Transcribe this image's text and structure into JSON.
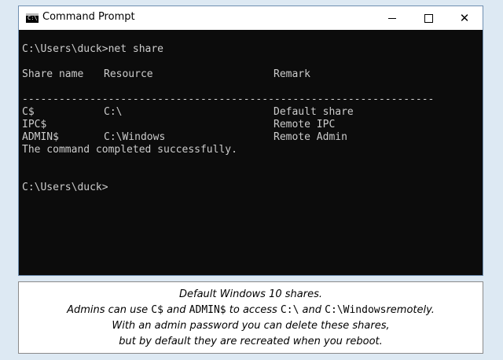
{
  "window": {
    "title": "Command Prompt",
    "icon": "cmd-icon",
    "icon_glyph": "C:\\",
    "controls": {
      "minimize": "minimize-icon",
      "maximize": "maximize-icon",
      "close": "close-icon",
      "close_glyph": "✕"
    }
  },
  "console": {
    "prompt1": "C:\\Users\\duck>net share",
    "header": {
      "share_name": "Share name",
      "resource": "Resource",
      "remark": "Remark"
    },
    "separator": "-------------------------------------------------------------------",
    "rows": [
      {
        "share": "C$",
        "resource": "C:\\",
        "remark": "Default share"
      },
      {
        "share": "IPC$",
        "resource": "",
        "remark": "Remote IPC"
      },
      {
        "share": "ADMIN$",
        "resource": "C:\\Windows",
        "remark": "Remote Admin"
      }
    ],
    "status": "The command completed successfully.",
    "prompt2": "C:\\Users\\duck>"
  },
  "caption": {
    "line1": "Default Windows 10 shares.",
    "line2": {
      "a": "Admins can use",
      "c_share": "C$",
      "and1": "and",
      "admin_share": "ADMIN$",
      "to_access": "to access",
      "c_drive": "C:\\",
      "and2": "and",
      "c_windows": "C:\\Windows",
      "remotely": "remotely."
    },
    "line3": "With an admin password you can delete these shares,",
    "line4": "but by default they are recreated when you reboot."
  }
}
